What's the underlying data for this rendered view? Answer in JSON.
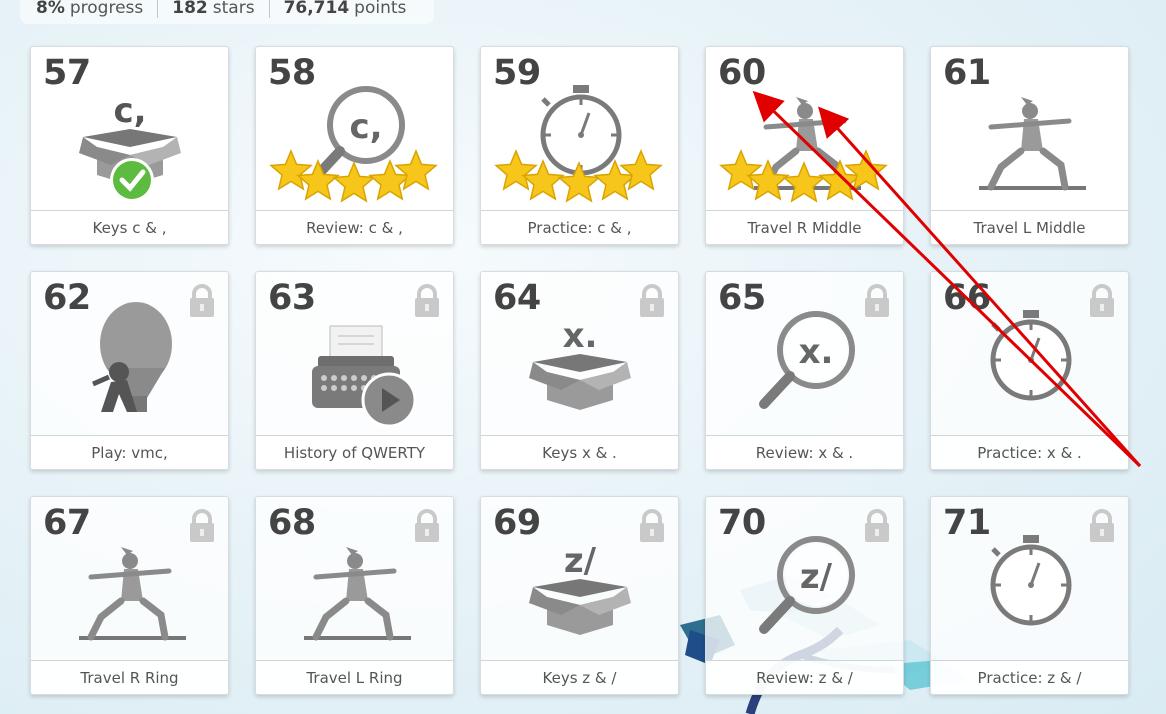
{
  "stats": {
    "progress_value": "8%",
    "progress_label": "progress",
    "stars_value": "182",
    "stars_label": "stars",
    "points_value": "76,714",
    "points_label": "points"
  },
  "lessons": [
    {
      "number": "57",
      "label": "Keys c & ,",
      "locked": false,
      "icon": "open-box-check-icon",
      "key_glyph": "c,"
    },
    {
      "number": "58",
      "label": "Review: c & ,",
      "locked": false,
      "icon": "magnifier-stars-icon",
      "key_glyph": "c,",
      "stars": 5
    },
    {
      "number": "59",
      "label": "Practice: c & ,",
      "locked": false,
      "icon": "stopwatch-stars-icon",
      "stars": 5
    },
    {
      "number": "60",
      "label": "Travel R Middle",
      "locked": false,
      "icon": "yoga-pose-stars-icon",
      "stars": 5
    },
    {
      "number": "61",
      "label": "Travel L Middle",
      "locked": false,
      "icon": "yoga-pose-icon"
    },
    {
      "number": "62",
      "label": "Play: vmc,",
      "locked": true,
      "icon": "hot-air-balloon-icon"
    },
    {
      "number": "63",
      "label": "History of QWERTY",
      "locked": true,
      "icon": "typewriter-video-icon"
    },
    {
      "number": "64",
      "label": "Keys x & .",
      "locked": true,
      "icon": "open-box-icon",
      "key_glyph": "x."
    },
    {
      "number": "65",
      "label": "Review: x & .",
      "locked": true,
      "icon": "magnifier-icon",
      "key_glyph": "x."
    },
    {
      "number": "66",
      "label": "Practice: x & .",
      "locked": true,
      "icon": "stopwatch-icon"
    },
    {
      "number": "67",
      "label": "Travel R Ring",
      "locked": true,
      "icon": "yoga-pose-icon"
    },
    {
      "number": "68",
      "label": "Travel L Ring",
      "locked": true,
      "icon": "yoga-pose-icon"
    },
    {
      "number": "69",
      "label": "Keys z & /",
      "locked": true,
      "icon": "open-box-icon",
      "key_glyph": "z/"
    },
    {
      "number": "70",
      "label": "Review: z & /",
      "locked": true,
      "icon": "magnifier-icon",
      "key_glyph": "z/"
    },
    {
      "number": "71",
      "label": "Practice: z & /",
      "locked": true,
      "icon": "stopwatch-icon"
    }
  ],
  "colors": {
    "star": "#f7c61a",
    "check": "#5dbb3f",
    "annotation": "#e00000",
    "icon_gray": "#8a8a8a"
  }
}
